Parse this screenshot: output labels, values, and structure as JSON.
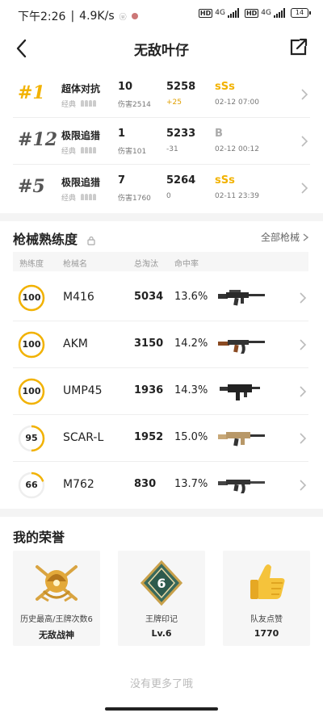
{
  "status": {
    "time": "下午2:26",
    "speed": "4.9K/s",
    "net1": "4G",
    "net2": "4G",
    "battery": "14"
  },
  "header": {
    "title": "无敌叶仔"
  },
  "matches": [
    {
      "rank": "#1",
      "rank_color": "#f2b200",
      "mode": "超体对抗",
      "sub": "经典",
      "kills": "10",
      "damage": "伤害2514",
      "score": "5258",
      "delta": "+25",
      "grade": "sSs",
      "grade_color": "#f2b200",
      "time": "02-12 07:00"
    },
    {
      "rank": "#12",
      "rank_color": "#555555",
      "mode": "极限追猎",
      "sub": "经典",
      "kills": "1",
      "damage": "伤害101",
      "score": "5233",
      "delta": "-31",
      "grade": "B",
      "grade_color": "#aaaaaa",
      "time": "02-12 00:12"
    },
    {
      "rank": "#5",
      "rank_color": "#555555",
      "mode": "极限追猎",
      "sub": "经典",
      "kills": "7",
      "damage": "伤害1760",
      "score": "5264",
      "delta": "0",
      "grade": "sSs",
      "grade_color": "#f2b200",
      "time": "02-11 23:39"
    }
  ],
  "weapons_section": {
    "title": "枪械熟练度",
    "all_link": "全部枪械",
    "columns": [
      "熟练度",
      "枪械名",
      "总淘汰",
      "命中率"
    ],
    "rows": [
      {
        "level": "100",
        "progress": 1.0,
        "name": "M416",
        "kills": "5034",
        "accuracy": "13.6%",
        "gun_icon": "m416-rifle-icon"
      },
      {
        "level": "100",
        "progress": 1.0,
        "name": "AKM",
        "kills": "3150",
        "accuracy": "14.2%",
        "gun_icon": "akm-rifle-icon"
      },
      {
        "level": "100",
        "progress": 1.0,
        "name": "UMP45",
        "kills": "1936",
        "accuracy": "14.3%",
        "gun_icon": "ump45-smg-icon"
      },
      {
        "level": "95",
        "progress": 0.5,
        "name": "SCAR-L",
        "kills": "1952",
        "accuracy": "15.0%",
        "gun_icon": "scar-l-rifle-icon"
      },
      {
        "level": "66",
        "progress": 0.2,
        "name": "M762",
        "kills": "830",
        "accuracy": "13.7%",
        "gun_icon": "m762-rifle-icon"
      }
    ]
  },
  "honors_section": {
    "title": "我的荣誉",
    "cards": [
      {
        "label": "历史最高/王牌次数6",
        "value": "无敌战神",
        "icon": "war-god-badge-icon"
      },
      {
        "label": "王牌印记",
        "value": "Lv.6",
        "icon": "ace-mark-icon"
      },
      {
        "label": "队友点赞",
        "value": "1770",
        "icon": "thumbs-up-icon"
      }
    ]
  },
  "footer": {
    "no_more": "没有更多了哦"
  },
  "colors": {
    "accent": "#f2b200",
    "ring_track": "#eeeeee"
  }
}
